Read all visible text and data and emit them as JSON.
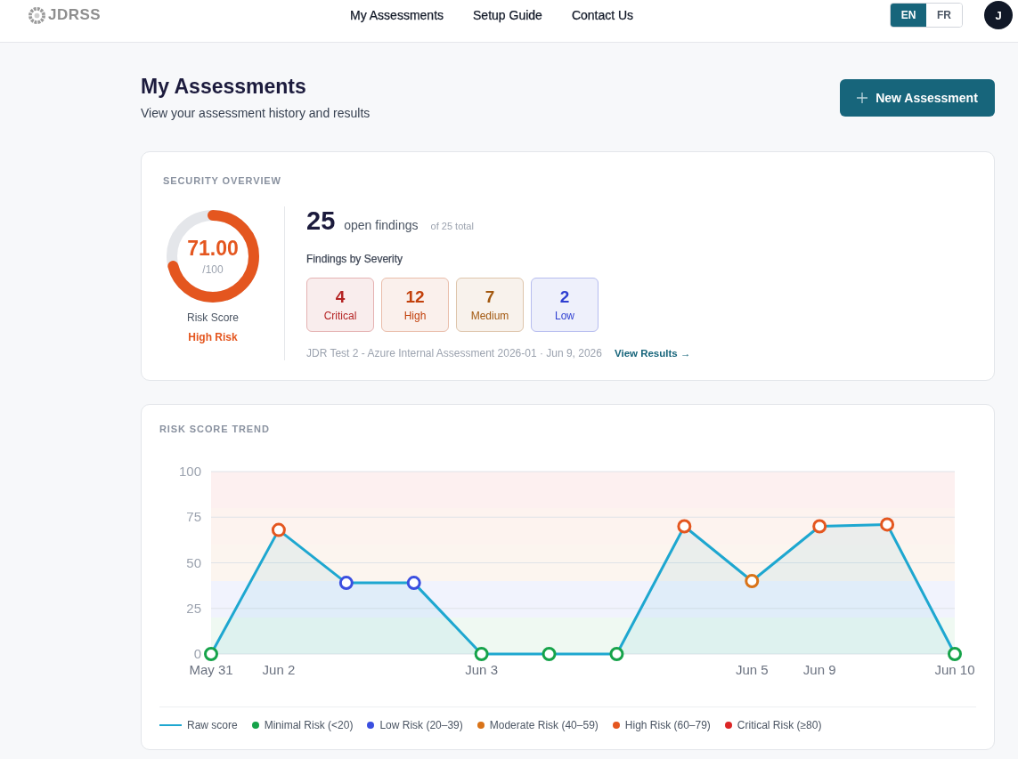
{
  "header": {
    "logo": {
      "text": "JDRSS"
    },
    "nav": [
      {
        "label": "My Assessments"
      },
      {
        "label": "Setup Guide"
      },
      {
        "label": "Contact Us"
      }
    ],
    "languages": [
      {
        "label": "EN",
        "selected": true
      },
      {
        "label": "FR",
        "selected": false
      }
    ],
    "avatar": {
      "initial": "J"
    }
  },
  "page": {
    "title": "My Assessments",
    "subtitle": "View your assessment history and results",
    "primary_button": {
      "label": "New Assessment"
    }
  },
  "security_overview": {
    "heading": "SECURITY OVERVIEW",
    "gauge": {
      "score": "71.00",
      "max": "/100",
      "level": 0.71,
      "label": "Risk Score",
      "rating": "High Risk"
    },
    "open_count": "25",
    "open_label": "open findings",
    "total": "of 25 total",
    "severity_heading": "Findings by Severity",
    "severities": [
      {
        "count": "4",
        "label": "Critical",
        "color": "#b42323"
      },
      {
        "count": "12",
        "label": "High",
        "color": "#c2410c"
      },
      {
        "count": "7",
        "label": "Medium",
        "color": "#a2580f"
      },
      {
        "count": "2",
        "label": "Low",
        "color": "#2f3fd1"
      }
    ],
    "latest": {
      "text": "JDR Test 2 - Azure Internal Assessment 2026-01 · Jun 9, 2026",
      "link": "View Results →"
    }
  },
  "risk_trend": {
    "heading": "RISK SCORE TREND",
    "chart_data": {
      "type": "area",
      "categories": [
        "May 31",
        "Jun 2",
        null,
        null,
        "Jun 3",
        null,
        null,
        null,
        "Jun 5",
        "Jun 9",
        null,
        "Jun 10"
      ],
      "series": [
        {
          "name": "Raw score",
          "color": "#1ea7d0",
          "values": [
            0,
            68,
            39,
            39,
            0,
            0,
            0,
            70,
            40,
            70,
            71,
            0
          ]
        }
      ],
      "ylim": [
        0,
        100
      ],
      "yticks": [
        0,
        25,
        50,
        75,
        100
      ],
      "grid": true,
      "bands": [
        {
          "axis": "y",
          "from": 0,
          "to": 20,
          "label": "Minimal Risk (<20)",
          "color": "#16a34a"
        },
        {
          "axis": "y",
          "from": 20,
          "to": 40,
          "label": "Low Risk (20–39)",
          "color": "#3b4fe0"
        },
        {
          "axis": "y",
          "from": 40,
          "to": 60,
          "label": "Moderate Risk (40–59)",
          "color": "#d97318"
        },
        {
          "axis": "y",
          "from": 60,
          "to": 80,
          "label": "High Risk (60–79)",
          "color": "#e4561f"
        },
        {
          "axis": "y",
          "from": 80,
          "to": 100,
          "label": "Critical Risk (≥80)",
          "color": "#dc2626"
        }
      ]
    }
  }
}
